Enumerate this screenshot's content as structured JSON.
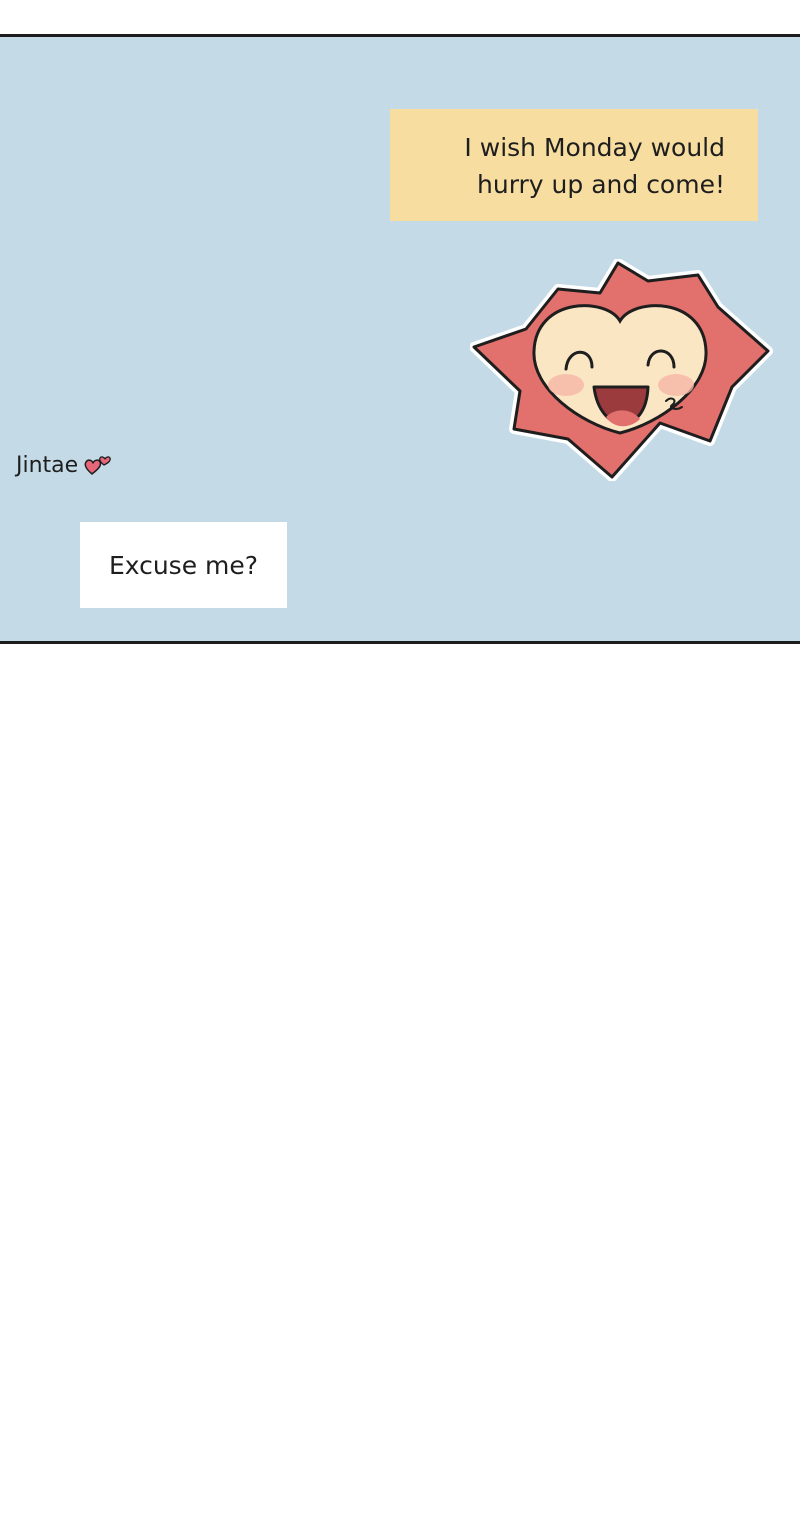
{
  "chat": {
    "outgoing_message": {
      "line_1": "I wish Monday would",
      "line_2": "hurry up and come!"
    },
    "sender_name": "Jintae",
    "sender_icon": "hearts-icon",
    "incoming_message": "Excuse me?",
    "sticker": "happy-heart-sticker-icon"
  },
  "colors": {
    "panel_background": "#c4dbe7",
    "outgoing_bubble": "#f7dea0",
    "incoming_bubble": "#ffffff",
    "sticker_burst": "#e2706c",
    "sticker_face": "#fbe6c4",
    "hearts": "#e7677a"
  }
}
